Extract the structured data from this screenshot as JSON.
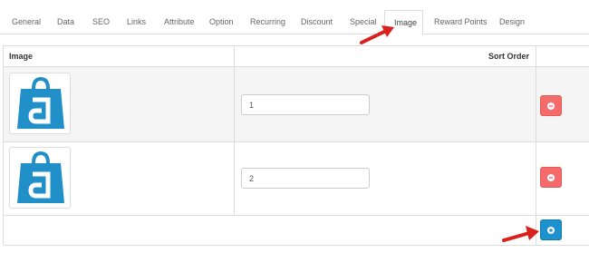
{
  "tabs": [
    {
      "label": "General"
    },
    {
      "label": "Data"
    },
    {
      "label": "SEO"
    },
    {
      "label": "Links"
    },
    {
      "label": "Attribute"
    },
    {
      "label": "Option"
    },
    {
      "label": "Recurring"
    },
    {
      "label": "Discount"
    },
    {
      "label": "Special"
    },
    {
      "label": "Image",
      "active": true
    },
    {
      "label": "Reward Points"
    },
    {
      "label": "Design"
    }
  ],
  "table": {
    "headers": {
      "image": "Image",
      "sort_order": "Sort Order"
    },
    "rows": [
      {
        "image": "shopping-bag-logo",
        "sort_order": "1"
      },
      {
        "image": "shopping-bag-logo",
        "sort_order": "2"
      }
    ]
  },
  "colors": {
    "brand_blue": "#2190c8",
    "danger": "#f56b6b",
    "primary": "#1e91cf",
    "arrow_red": "#d9201c"
  },
  "icons": {
    "remove": "minus-circle-icon",
    "add": "plus-circle-icon",
    "annotation": "red-arrow-icon"
  }
}
